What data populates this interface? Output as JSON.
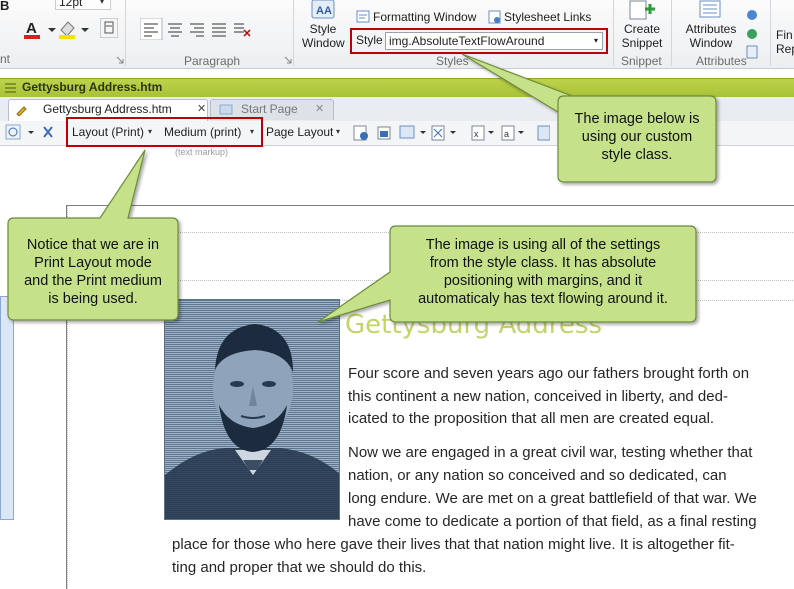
{
  "ribbon": {
    "font_size": "12pt",
    "styles_group": {
      "formatting_window": "Formatting Window",
      "stylesheet_links": "Stylesheet Links",
      "style_window": [
        "Style",
        "Window"
      ],
      "style_label": "Style",
      "style_value": "img.AbsoluteTextFlowAround",
      "group_label": "Styles"
    },
    "paragraph_group_label": "Paragraph",
    "snippet": {
      "label": [
        "Create",
        "Snippet"
      ],
      "group_label": "Snippet"
    },
    "attributes": {
      "label": [
        "Attributes",
        "Window"
      ],
      "group_label": "Attributes"
    },
    "cut_off_right": [
      "Fin",
      "Rep"
    ],
    "cut_off_left": [
      "B",
      "nt"
    ]
  },
  "document": {
    "title": "Gettysburg Address.htm",
    "tabs": [
      {
        "label": "Gettysburg Address.htm"
      },
      {
        "label": "Start Page"
      }
    ]
  },
  "doc_toolbar": {
    "layout": "Layout (Print)",
    "medium": "Medium (print)",
    "page_layout": "Page Layout",
    "text_markup": "(text markup)"
  },
  "content": {
    "heading": "Gettysburg Address",
    "para1": [
      "Four score and seven years ago our fathers brought forth on",
      "this continent a new nation, conceived in liberty, and ded-",
      "icated to the proposition that all men are created equal."
    ],
    "para2": [
      "Now we are engaged in a great civil war, testing whether that",
      "nation, or any nation so conceived and so dedicated, can",
      "long endure. We are met on a great battlefield of that war. We",
      "have come to dedicate a portion of that field, as a final resting",
      "place for those who here gave their lives that that nation might live. It is altogether fit-",
      "ting and proper that we should do this."
    ]
  },
  "callouts": {
    "top_right": [
      "The image below is",
      "using our custom",
      "style class."
    ],
    "left": [
      "Notice that we are in",
      "Print Layout mode",
      "and the Print medium",
      "is being used."
    ],
    "center": [
      "The image is using all of the settings",
      "from the style class. It has absolute",
      "positioning with margins, and it",
      "automaticaly has text flowing around it."
    ]
  },
  "colors": {
    "callout_fill": "#c5e28a",
    "callout_border": "#6d8a3a",
    "highlight_box": "#c00000",
    "titlebar": "#b4cc40",
    "heading": "#c4d36a"
  }
}
